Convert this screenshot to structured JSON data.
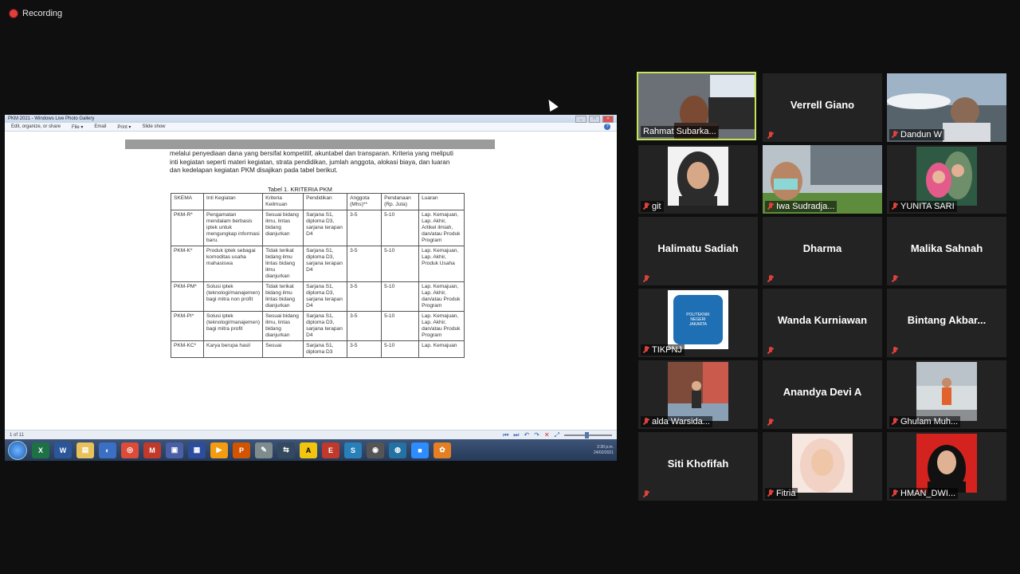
{
  "recording": {
    "label": "Recording"
  },
  "shared_window": {
    "title": "PKM 2021 - Windows Live Photo Gallery",
    "menu": [
      "Edit, organize, or share",
      "File ▾",
      "Email",
      "Print ▾",
      "Slide show"
    ],
    "help": "?",
    "paragraph": "melalui penyediaan dana yang bersifat kompetitif, akuntabel dan transparan. Kriteria yang meliputi inti kegiatan seperti materi kegiatan, strata pendidikan, jumlah anggota, alokasi biaya, dan luaran dan kedelapan kegiatan PKM disajikan pada tabel berikut.",
    "caption": "Tabel 1. KRITERIA PKM",
    "table": {
      "headers": [
        "SKEMA",
        "Inti Kegiatan",
        "Kriteria Keilmuan",
        "Pendidikan",
        "Anggota (Mhs)**",
        "Pendanaan (Rp. Juta)",
        "Luaran"
      ],
      "rows": [
        [
          "PKM-R*",
          "Pengamatan mendalam berbasis iptek untuk mengungkap informasi baru.",
          "Sesuai bidang ilmu, lintas bidang dianjurkan",
          "Sarjana S1, diploma D3, sarjana terapan D4",
          "3-5",
          "5-10",
          "Lap. Kemajuan, Lap. Akhir, Artikel ilmiah, dan/atau Produk Program"
        ],
        [
          "PKM-K*",
          "Produk iptek sebagai komoditas usaha mahasiswa",
          "Tidak terikat bidang ilmu lintas bidang ilmu dianjurkan",
          "Sarjana S1, diploma D3, sarjana terapan D4",
          "3-5",
          "5-10",
          "Lap. Kemajuan, Lap. Akhir, Produk Usaha"
        ],
        [
          "PKM-PM*",
          "Solusi iptek (teknologi/manajemen) bagi mitra non profit",
          "Tidak terikat bidang ilmu lintas bidang dianjurkan",
          "Sarjana S1, diploma D3, sarjana terapan D4",
          "3-5",
          "5-10",
          "Lap. Kemajuan, Lap. Akhir, dan/atau Produk Program"
        ],
        [
          "PKM-PI*",
          "Solusi iptek (teknologi/manajemen) bagi mitra profit",
          "Sesuai bidang ilmu, lintas bidang dianjurkan",
          "Sarjana S1, diploma D3, sarjana terapan D4",
          "3-5",
          "5-10",
          "Lap. Kemajuan, Lap. Akhir, dan/atau Produk Program"
        ],
        [
          "PKM-KC*",
          "Karya berupa hasil",
          "Sesuai",
          "Sarjana S1, diploma D3",
          "3-5",
          "5-10",
          "Lap. Kemajuan"
        ]
      ]
    },
    "status_left": "1 of 11",
    "taskbar_time": "2:30 p.m.",
    "taskbar_date": "24/02/2021"
  },
  "participants": [
    {
      "name": "Rahmat Subarka...",
      "video": true,
      "active": true
    },
    {
      "name": "Verrell Giano",
      "video": false
    },
    {
      "name": "Dandun W",
      "video": true
    },
    {
      "name": "git",
      "video": true
    },
    {
      "name": "Iwa Sudradja...",
      "video": true
    },
    {
      "name": "YUNITA SARI",
      "video": true
    },
    {
      "name": "Halimatu Sadiah",
      "video": false
    },
    {
      "name": "Dharma",
      "video": false
    },
    {
      "name": "Malika Sahnah",
      "video": false
    },
    {
      "name": "TIKPNJ",
      "video": true,
      "logo_text": "POLITEKNIK NEGERI JAKARTA"
    },
    {
      "name": "Wanda Kurniawan",
      "video": false
    },
    {
      "name": "Bintang  Akbar...",
      "video": false
    },
    {
      "name": "alda Warsida...",
      "video": true
    },
    {
      "name": "Anandya Devi A",
      "video": false
    },
    {
      "name": "Ghulam Muh...",
      "video": true
    },
    {
      "name": "Siti Khofifah",
      "video": false
    },
    {
      "name": "Fitria",
      "video": true
    },
    {
      "name": "HMAN_DWI...",
      "video": true
    }
  ]
}
